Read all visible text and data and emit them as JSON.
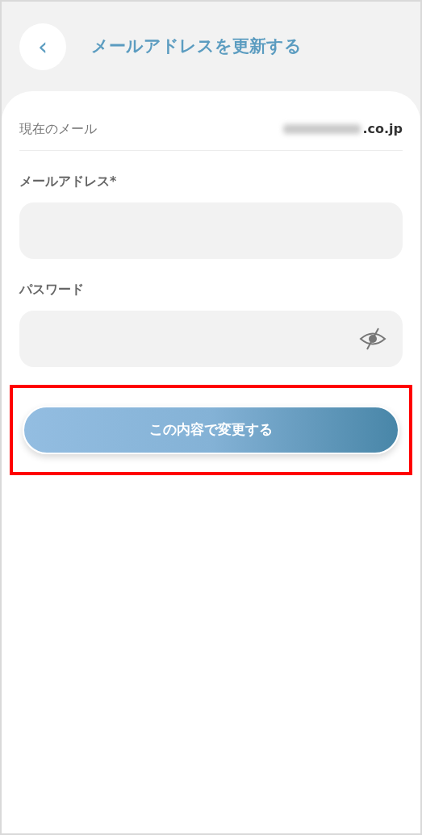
{
  "header": {
    "back_icon": "‹",
    "title": "メールアドレスを更新する"
  },
  "current_email": {
    "label": "現在のメール",
    "value": ".co.jp",
    "redacted": true
  },
  "fields": [
    {
      "label": "メールアドレス*",
      "kind": "text"
    },
    {
      "label": "パスワード",
      "kind": "password"
    }
  ],
  "submit_button": {
    "label": "この内容で変更する",
    "highlighted": true
  }
}
